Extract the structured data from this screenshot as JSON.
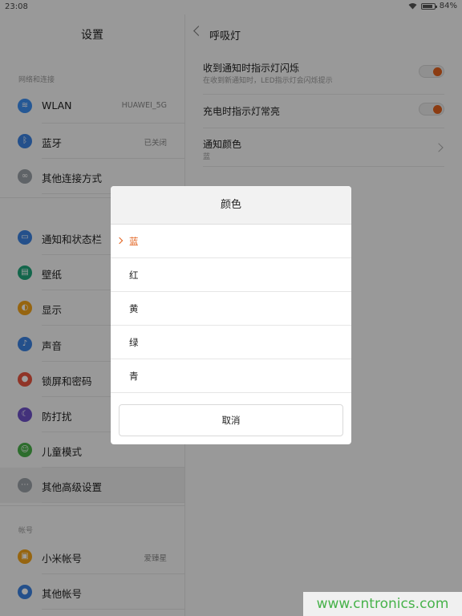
{
  "status_bar": {
    "time": "23:08",
    "battery": "84%",
    "battery_level": 0.84
  },
  "left": {
    "title": "设置",
    "section_network": "网络和连接",
    "items_network": [
      {
        "label": "WLAN",
        "value": "HUAWEI_5G",
        "icon": "wifi-icon",
        "color": "#3d8ef0"
      },
      {
        "label": "蓝牙",
        "value": "已关闭",
        "icon": "bluetooth-icon",
        "color": "#3a82e0"
      },
      {
        "label": "其他连接方式",
        "value": "",
        "icon": "link-icon",
        "color": "#9aa0a6"
      }
    ],
    "items_personal": [
      {
        "label": "通知和状态栏",
        "icon": "notification-icon",
        "color": "#3a82e0"
      },
      {
        "label": "壁纸",
        "icon": "wallpaper-icon",
        "color": "#1fa57a"
      },
      {
        "label": "显示",
        "icon": "display-icon",
        "color": "#f2a31b"
      },
      {
        "label": "声音",
        "icon": "sound-icon",
        "color": "#3a82e0"
      },
      {
        "label": "锁屏和密码",
        "icon": "lock-icon",
        "color": "#e8543f"
      },
      {
        "label": "防打扰",
        "icon": "moon-icon",
        "color": "#6c4fc7"
      },
      {
        "label": "儿童模式",
        "icon": "child-icon",
        "color": "#49b04a"
      },
      {
        "label": "其他高级设置",
        "icon": "more-icon",
        "color": "#9aa0a6"
      }
    ],
    "section_account": "帐号",
    "items_account": [
      {
        "label": "小米帐号",
        "value": "爱臻星",
        "icon": "mi-account-icon",
        "color": "#f2a31b"
      },
      {
        "label": "其他帐号",
        "value": "",
        "icon": "account-icon",
        "color": "#3a82e0"
      }
    ]
  },
  "right": {
    "title": "呼吸灯",
    "row1_title": "收到通知时指示灯闪烁",
    "row1_sub": "在收到新通知时，LED指示灯会闪烁提示",
    "row2_title": "充电时指示灯常亮",
    "row3_title": "通知颜色",
    "row3_sub": "蓝"
  },
  "dialog": {
    "title": "颜色",
    "options": [
      "蓝",
      "红",
      "黄",
      "绿",
      "青"
    ],
    "selected_index": 0,
    "cancel": "取消"
  },
  "watermark": "www.cntronics.com",
  "colors": {
    "accent": "#e2621e",
    "watermark": "#47b24a"
  }
}
